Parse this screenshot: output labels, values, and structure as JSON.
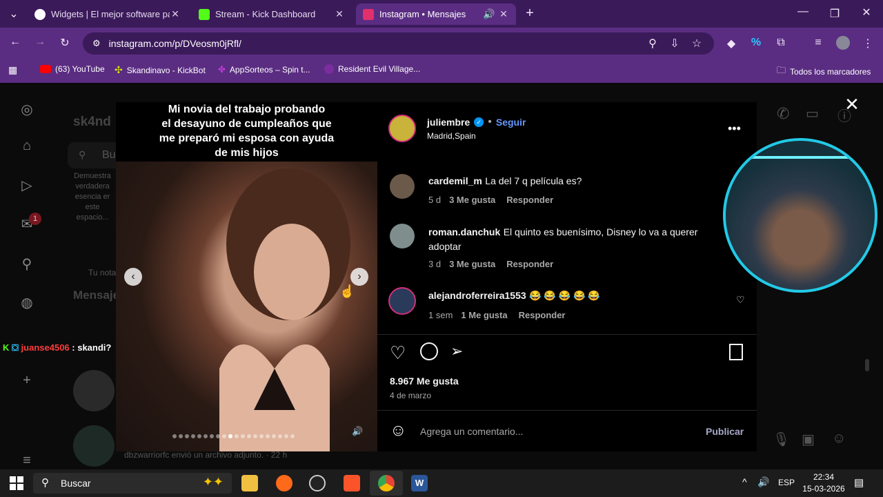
{
  "browser": {
    "tabs": [
      {
        "title": "Widgets | El mejor software pa",
        "favicon_color": "#ffffff"
      },
      {
        "title": "Stream - Kick Dashboard",
        "favicon_color": "#53fc18"
      },
      {
        "title": "Instagram • Mensajes",
        "favicon_color": "#e1306c"
      }
    ],
    "url": "instagram.com/p/DVeosm0jRfl/",
    "bookmarks": [
      {
        "label": "(63) YouTube",
        "color": "#ff0000"
      },
      {
        "label": "Skandinavo - KickBot",
        "color": "#d4e600"
      },
      {
        "label": "AppSorteos – Spin t...",
        "color": "#c039d6"
      },
      {
        "label": "Resident Evil Village...",
        "color": "#7b2d9e"
      }
    ],
    "all_bookmarks": "Todos los marcadores"
  },
  "background": {
    "username": "sk4nd",
    "search_placeholder": "Bu",
    "note_lines": [
      "Demuestra",
      "verdadera",
      "esencia er",
      "este",
      "espacio..."
    ],
    "tu_nota": "Tu nota",
    "mensajes": "Mensaje",
    "notification_count": "1",
    "last_message": "dbzwarriorfc envió un archivo adjunto. · 22 h"
  },
  "chat_overlay": {
    "user": "juanse4506",
    "message": ": skandi?"
  },
  "post": {
    "caption_lines": [
      "Mi novia del trabajo probando",
      "el desayuno de cumpleaños que",
      "me preparó mi esposa con ayuda",
      "de mis hijos"
    ],
    "author": "juliembre",
    "follow": "Seguir",
    "location": "Madrid,Spain",
    "comments": [
      {
        "user": "cardemil_m",
        "text": "La del 7 q película es?",
        "time": "5 d",
        "likes": "3 Me gusta",
        "reply": "Responder"
      },
      {
        "user": "roman.danchuk",
        "text": "El quinto es buenísimo, Disney lo va a querer",
        "text2": "adoptar",
        "time": "3 d",
        "likes": "3 Me gusta",
        "reply": "Responder"
      },
      {
        "user": "alejandroferreira1553",
        "text": "😂 😂 😂 😂 😂",
        "time": "1 sem",
        "likes": "1 Me gusta",
        "reply": "Responder"
      }
    ],
    "likes_count": "8.967 Me gusta",
    "date": "4 de marzo",
    "comment_placeholder": "Agrega un comentario...",
    "publish": "Publicar",
    "carousel_dots": 20,
    "active_dot": 9
  },
  "taskbar": {
    "search": "Buscar",
    "lang": "ESP",
    "time": "22:34",
    "date": "15-03-2026"
  }
}
